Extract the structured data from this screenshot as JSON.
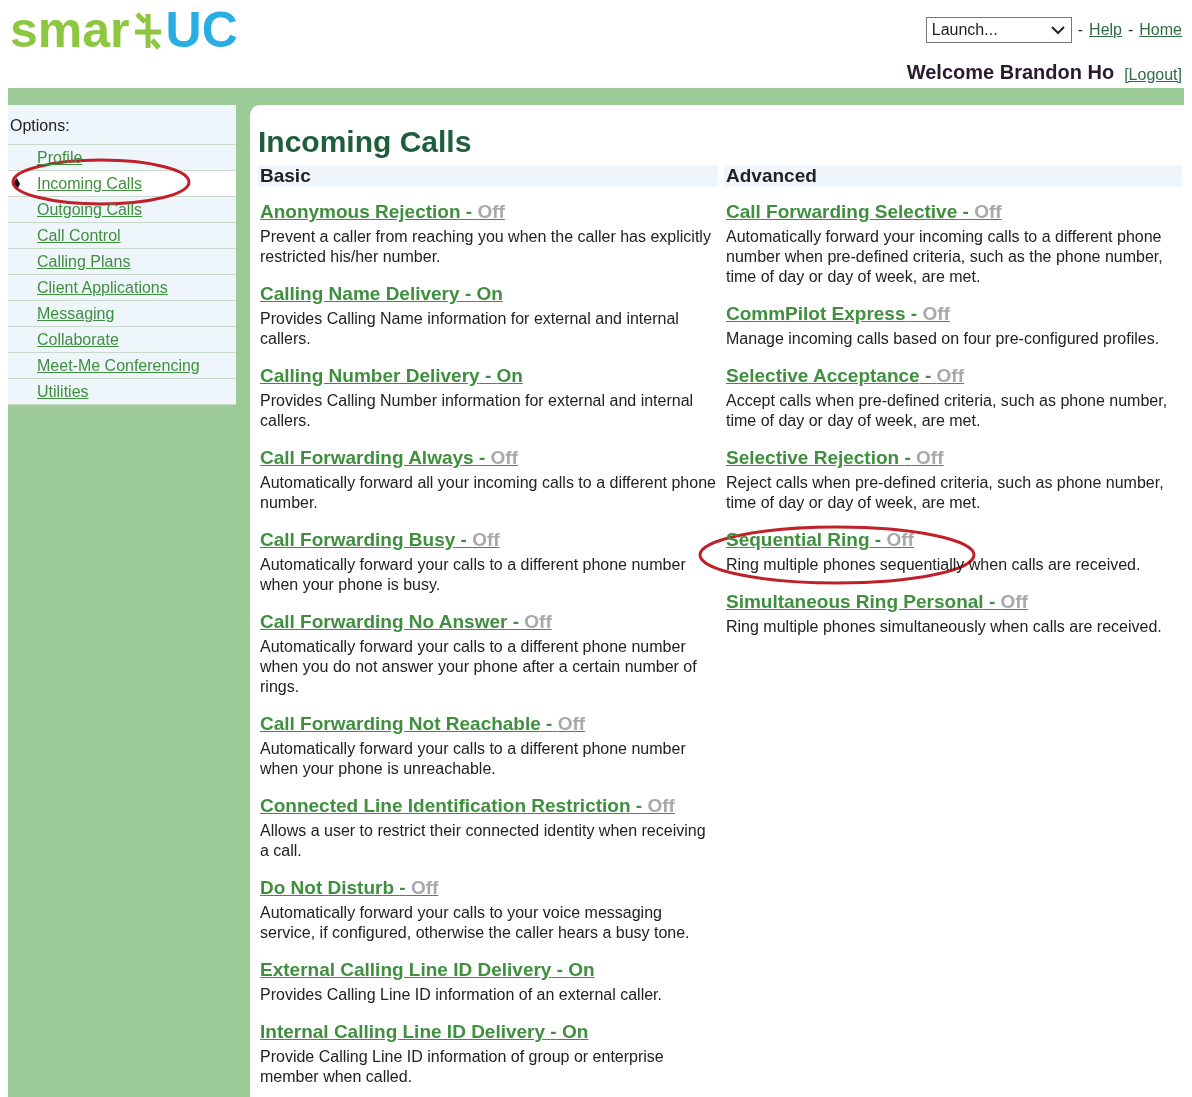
{
  "logo": {
    "left": "smar",
    "right": "UC"
  },
  "header": {
    "launch_select": "Launch...",
    "links": [
      {
        "separator": "-",
        "label": "Help"
      },
      {
        "separator": "-",
        "label": "Home"
      }
    ],
    "welcome": "Welcome Brandon Ho",
    "logout": "[Logout]"
  },
  "sidebar": {
    "title": "Options:",
    "items": [
      {
        "label": "Profile",
        "selected": false
      },
      {
        "label": "Incoming Calls",
        "selected": true
      },
      {
        "label": "Outgoing Calls",
        "selected": false
      },
      {
        "label": "Call Control",
        "selected": false
      },
      {
        "label": "Calling Plans",
        "selected": false
      },
      {
        "label": "Client Applications",
        "selected": false
      },
      {
        "label": "Messaging",
        "selected": false
      },
      {
        "label": "Collaborate",
        "selected": false
      },
      {
        "label": "Meet-Me Conferencing",
        "selected": false
      },
      {
        "label": "Utilities",
        "selected": false
      }
    ]
  },
  "page_title": "Incoming Calls",
  "status_separator": "-",
  "sections": [
    {
      "heading": "Basic",
      "features": [
        {
          "name": "Anonymous Rejection",
          "status": "Off",
          "on": false,
          "description": "Prevent a caller from reaching you when the caller has explicitly restricted his/her number."
        },
        {
          "name": "Calling Name Delivery",
          "status": "On",
          "on": true,
          "description": "Provides Calling Name information for external and internal callers."
        },
        {
          "name": "Calling Number Delivery",
          "status": "On",
          "on": true,
          "description": "Provides Calling Number information for external and internal callers."
        },
        {
          "name": "Call Forwarding Always",
          "status": "Off",
          "on": false,
          "description": "Automatically forward all your incoming calls to a different phone number."
        },
        {
          "name": "Call Forwarding Busy",
          "status": "Off",
          "on": false,
          "description": "Automatically forward your calls to a different phone number when your phone is busy."
        },
        {
          "name": "Call Forwarding No Answer",
          "status": "Off",
          "on": false,
          "description": "Automatically forward your calls to a different phone number when you do not answer your phone after a certain number of rings."
        },
        {
          "name": "Call Forwarding Not Reachable",
          "status": "Off",
          "on": false,
          "description": "Automatically forward your calls to a different phone number when your phone is unreachable."
        },
        {
          "name": "Connected Line Identification Restriction",
          "status": "Off",
          "on": false,
          "description": "Allows a user to restrict their connected identity when receiving a call."
        },
        {
          "name": "Do Not Disturb",
          "status": "Off",
          "on": false,
          "description": "Automatically forward your calls to your voice messaging service, if configured, otherwise the caller hears a busy tone."
        },
        {
          "name": "External Calling Line ID Delivery",
          "status": "On",
          "on": true,
          "description": "Provides Calling Line ID information of an external caller."
        },
        {
          "name": "Internal Calling Line ID Delivery",
          "status": "On",
          "on": true,
          "description": "Provide Calling Line ID information of group or enterprise member when called."
        }
      ]
    },
    {
      "heading": "Advanced",
      "features": [
        {
          "name": "Call Forwarding Selective",
          "status": "Off",
          "on": false,
          "description": "Automatically forward your incoming calls to a different phone number when pre-defined criteria, such as the phone number, time of day or day of week, are met."
        },
        {
          "name": "CommPilot Express",
          "status": "Off",
          "on": false,
          "description": "Manage incoming calls based on four pre-configured profiles."
        },
        {
          "name": "Selective Acceptance",
          "status": "Off",
          "on": false,
          "description": "Accept calls when pre-defined criteria, such as phone number, time of day or day of week, are met."
        },
        {
          "name": "Selective Rejection",
          "status": "Off",
          "on": false,
          "description": "Reject calls when pre-defined criteria, such as phone number, time of day or day of week, are met."
        },
        {
          "name": "Sequential Ring",
          "status": "Off",
          "on": false,
          "description": "Ring multiple phones sequentially when calls are received."
        },
        {
          "name": "Simultaneous Ring Personal",
          "status": "Off",
          "on": false,
          "description": "Ring multiple phones simultaneously when calls are received."
        }
      ]
    }
  ]
}
